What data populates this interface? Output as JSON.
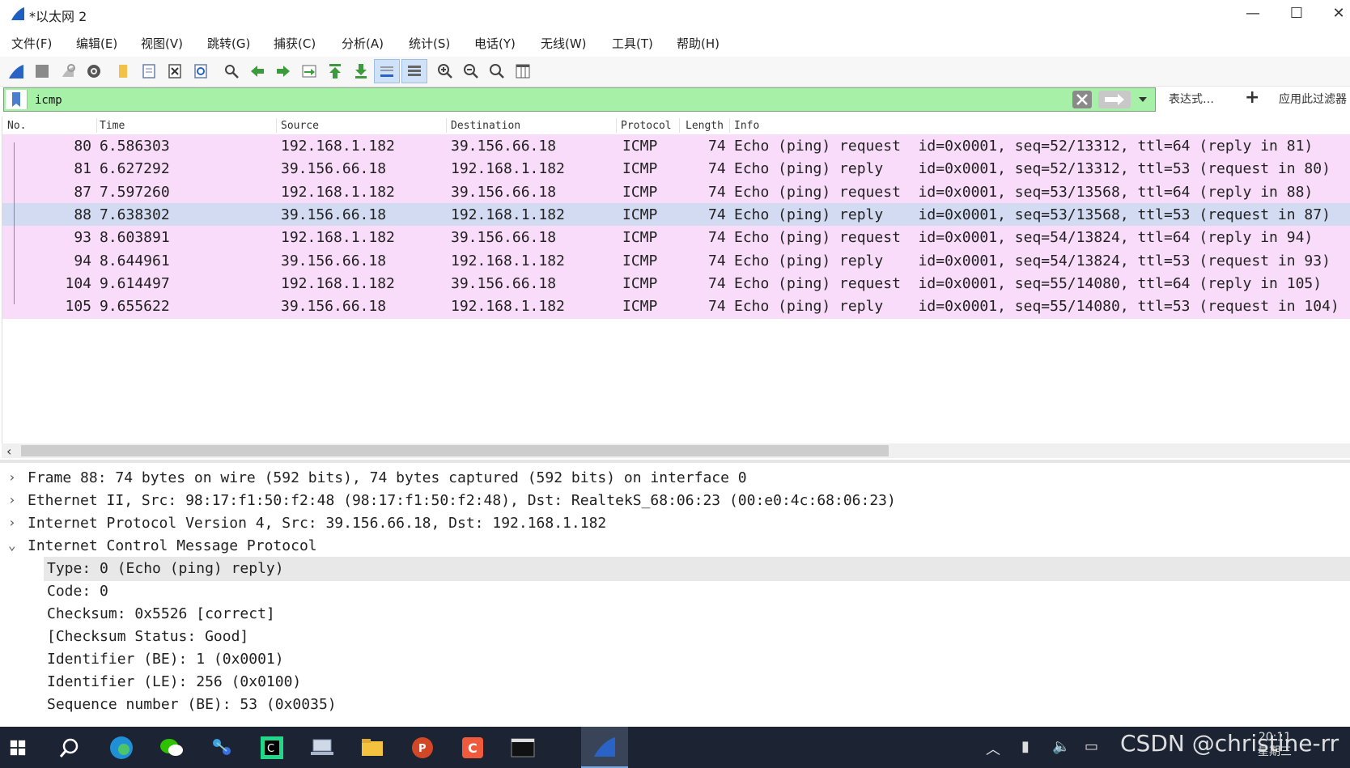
{
  "window": {
    "title": "*以太网 2"
  },
  "menu": [
    "文件(F)",
    "编辑(E)",
    "视图(V)",
    "跳转(G)",
    "捕获(C)",
    "分析(A)",
    "统计(S)",
    "电话(Y)",
    "无线(W)",
    "工具(T)",
    "帮助(H)"
  ],
  "filter": {
    "value": "icmp",
    "expression_label": "表达式…",
    "add_label": "+",
    "apply_label": "应用此过滤器"
  },
  "packet_list": {
    "columns": [
      "No.",
      "Time",
      "Source",
      "Destination",
      "Protocol",
      "Length",
      "Info"
    ],
    "rows": [
      {
        "no": "80",
        "time": "6.586303",
        "src": "192.168.1.182",
        "dst": "39.156.66.18",
        "proto": "ICMP",
        "len": "74",
        "info": "Echo (ping) request  id=0x0001, seq=52/13312, ttl=64 (reply in 81)"
      },
      {
        "no": "81",
        "time": "6.627292",
        "src": "39.156.66.18",
        "dst": "192.168.1.182",
        "proto": "ICMP",
        "len": "74",
        "info": "Echo (ping) reply    id=0x0001, seq=52/13312, ttl=53 (request in 80)"
      },
      {
        "no": "87",
        "time": "7.597260",
        "src": "192.168.1.182",
        "dst": "39.156.66.18",
        "proto": "ICMP",
        "len": "74",
        "info": "Echo (ping) request  id=0x0001, seq=53/13568, ttl=64 (reply in 88)"
      },
      {
        "no": "88",
        "time": "7.638302",
        "src": "39.156.66.18",
        "dst": "192.168.1.182",
        "proto": "ICMP",
        "len": "74",
        "info": "Echo (ping) reply    id=0x0001, seq=53/13568, ttl=53 (request in 87)"
      },
      {
        "no": "93",
        "time": "8.603891",
        "src": "192.168.1.182",
        "dst": "39.156.66.18",
        "proto": "ICMP",
        "len": "74",
        "info": "Echo (ping) request  id=0x0001, seq=54/13824, ttl=64 (reply in 94)"
      },
      {
        "no": "94",
        "time": "8.644961",
        "src": "39.156.66.18",
        "dst": "192.168.1.182",
        "proto": "ICMP",
        "len": "74",
        "info": "Echo (ping) reply    id=0x0001, seq=54/13824, ttl=53 (request in 93)"
      },
      {
        "no": "104",
        "time": "9.614497",
        "src": "192.168.1.182",
        "dst": "39.156.66.18",
        "proto": "ICMP",
        "len": "74",
        "info": "Echo (ping) request  id=0x0001, seq=55/14080, ttl=64 (reply in 105)"
      },
      {
        "no": "105",
        "time": "9.655622",
        "src": "39.156.66.18",
        "dst": "192.168.1.182",
        "proto": "ICMP",
        "len": "74",
        "info": "Echo (ping) reply    id=0x0001, seq=55/14080, ttl=53 (request in 104)"
      }
    ],
    "selected_no": "88"
  },
  "details": {
    "frame": "Frame 88: 74 bytes on wire (592 bits), 74 bytes captured (592 bits) on interface 0",
    "ethernet": "Ethernet II, Src: 98:17:f1:50:f2:48 (98:17:f1:50:f2:48), Dst: RealtekS_68:06:23 (00:e0:4c:68:06:23)",
    "ip": "Internet Protocol Version 4, Src: 39.156.66.18, Dst: 192.168.1.182",
    "icmp": "Internet Control Message Protocol",
    "icmp_fields": [
      "Type: 0 (Echo (ping) reply)",
      "Code: 0",
      "Checksum: 0x5526 [correct]",
      "[Checksum Status: Good]",
      "Identifier (BE): 1 (0x0001)",
      "Identifier (LE): 256 (0x0100)",
      "Sequence number (BE): 53 (0x0035)"
    ]
  },
  "taskbar": {
    "watermark": "CSDN @christine-rr",
    "clock_time": "20:11",
    "clock_day": "星期三"
  },
  "colors": {
    "icmp_row": "#f9dcf9",
    "selected_row": "#d3dbf2",
    "filter_ok": "#a7f0a7"
  }
}
